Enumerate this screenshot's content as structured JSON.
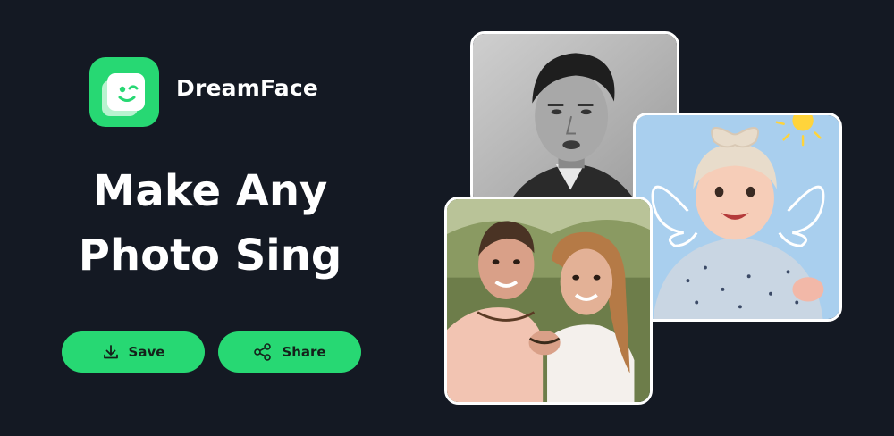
{
  "brand": {
    "name": "DreamFace",
    "logo_icon": "winking-face-logo-icon",
    "accent_color": "#27d873"
  },
  "headline": {
    "line1": "Make Any",
    "line2": "Photo Sing"
  },
  "actions": {
    "save": {
      "label": "Save",
      "icon": "download-icon"
    },
    "share": {
      "label": "Share",
      "icon": "share-icon"
    }
  },
  "gallery": {
    "items": [
      {
        "name": "vintage-portrait",
        "tone": "black-and-white"
      },
      {
        "name": "couple-photo",
        "tone": "color"
      },
      {
        "name": "baby-photo",
        "tone": "color"
      }
    ]
  },
  "colors": {
    "background": "#141923",
    "button": "#27d873",
    "button_text": "#14201a",
    "text": "#ffffff"
  }
}
